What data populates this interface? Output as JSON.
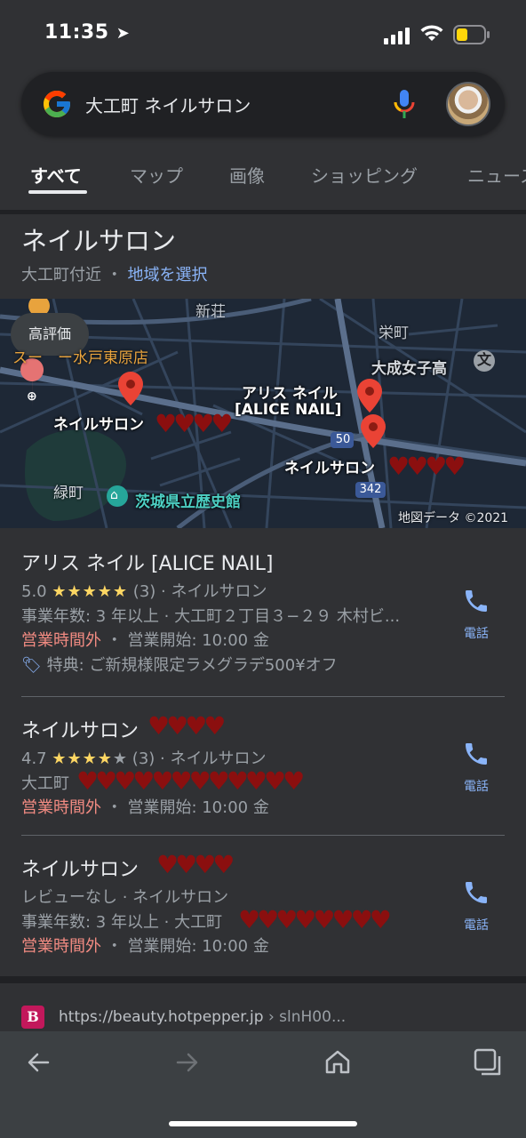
{
  "status": {
    "time": "11:35"
  },
  "search": {
    "query": "大工町 ネイルサロン"
  },
  "tabs": [
    {
      "label": "すべて"
    },
    {
      "label": "マップ"
    },
    {
      "label": "画像"
    },
    {
      "label": "ショッピング"
    },
    {
      "label": "ニュース"
    }
  ],
  "local": {
    "title": "ネイルサロン",
    "near": "大工町付近",
    "dot": "・",
    "choose_area": "地域を選択"
  },
  "map": {
    "chip": "高評価",
    "places": {
      "shinso": "新荘",
      "sakaecho": "栄町",
      "taisei": "大成女子高",
      "midoricho": "緑町",
      "museum": "茨城県立歴史館",
      "store": "スー　ー水戸東原店",
      "route50": "50",
      "route342": "342"
    },
    "pins": {
      "alice_line1": "アリス ネイル",
      "alice_line2": "[ALICE NAIL]",
      "salon_a": "ネイルサロン",
      "salon_b": "ネイルサロン"
    },
    "credit": "地図データ ©2021"
  },
  "listings": [
    {
      "name": "アリス ネイル [ALICE NAIL]",
      "rating": "5.0",
      "stars": "★★★★★",
      "stars_empty": "",
      "reviews": "(3) · ネイルサロン",
      "address": "事業年数: 3 年以上 · 大工町２丁目３−２９ 木村ビ...",
      "status_closed": "営業時間外",
      "hours": " ・ 営業開始: 10:00 金",
      "offer": "特典: ご新規様限定ラメグラデ500¥オフ",
      "call": "電話"
    },
    {
      "name": "ネイルサロン",
      "rating": "4.7",
      "stars": "★★★★",
      "stars_empty": "★",
      "reviews": "(3) · ネイルサロン",
      "address": "大工町",
      "status_closed": "営業時間外",
      "hours": " ・ 営業開始: 10:00 金",
      "call": "電話"
    },
    {
      "name": "ネイルサロン",
      "rating_text": "レビューなし · ネイルサロン",
      "address": "事業年数: 3 年以上 · 大工町",
      "status_closed": "営業時間外",
      "hours": " ・ 営業開始: 10:00 金",
      "call": "電話"
    }
  ],
  "result": {
    "favicon": "B",
    "url": "https://beauty.hotpepper.jp",
    "path": " › slnH00..."
  },
  "colors": {
    "background": "#303134",
    "link": "#8ab4f8",
    "closed": "#f28b82",
    "star": "#fdd663",
    "pin": "#ea4335",
    "redaction": "#8b0f0f"
  }
}
